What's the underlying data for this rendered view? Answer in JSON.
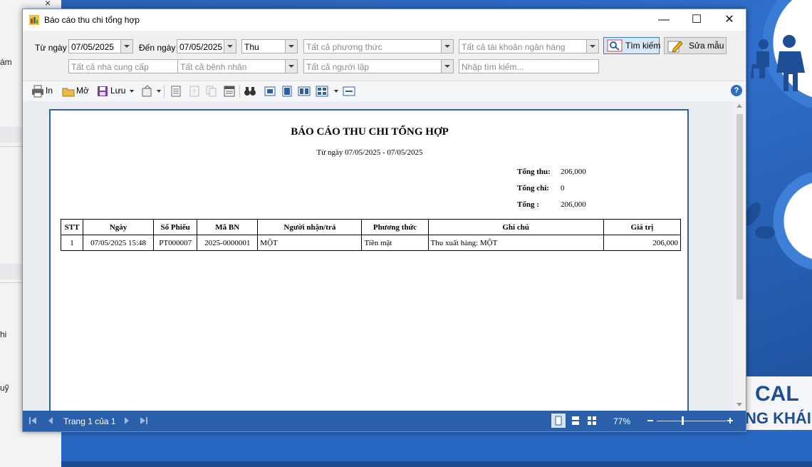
{
  "background": {
    "left_fragments": [
      "ám",
      "hi",
      "uỹ"
    ],
    "banner_line1": "CAL",
    "banner_line2": "NG KHÁI"
  },
  "window": {
    "title": "Báo cáo thu chi tổng hợp",
    "controls": {
      "minimize": "—",
      "maximize": "☐",
      "close": "✕"
    }
  },
  "filters": {
    "from_label": "Từ ngày",
    "from_value": "07/05/2025",
    "to_label": "Đến ngày",
    "to_value": "07/05/2025",
    "type_value": "Thu",
    "payment_method_placeholder": "Tất cả phương thức",
    "bank_account_placeholder": "Tất cả tài khoản ngân hàng",
    "supplier_placeholder": "Tất cả nhà cung cấp",
    "patient_placeholder": "Tất cả bệnh nhân",
    "creator_placeholder": "Tất cả người lập",
    "search_placeholder": "Nhập tìm kiếm...",
    "search_button": "Tìm kiếm",
    "edit_template_button": "Sửa mẫu"
  },
  "toolbar": {
    "print_label": "In",
    "open_label": "Mở",
    "save_label": "Lưu",
    "help_label": "?"
  },
  "report": {
    "title": "BÁO CÁO THU CHI TỔNG HỢP",
    "subtitle": "Từ ngày 07/05/2025 - 07/05/2025",
    "totals": [
      {
        "label": "Tổng thu:",
        "value": "206,000"
      },
      {
        "label": "Tổng chi:",
        "value": "0"
      },
      {
        "label": "Tổng :",
        "value": "206,000"
      }
    ],
    "columns": [
      "STT",
      "Ngày",
      "Số Phiếu",
      "Mã BN",
      "Người nhận/trả",
      "Phương thức",
      "Ghi chú",
      "Giá trị"
    ],
    "rows": [
      [
        "1",
        "07/05/2025 15:48",
        "PT000007",
        "2025-0000001",
        "MỘT",
        "Tiền mặt",
        "Thu xuất hàng: MỘT",
        "206,000"
      ]
    ]
  },
  "statusbar": {
    "page_text": "Trang 1 của 1",
    "zoom_text": "77%"
  }
}
